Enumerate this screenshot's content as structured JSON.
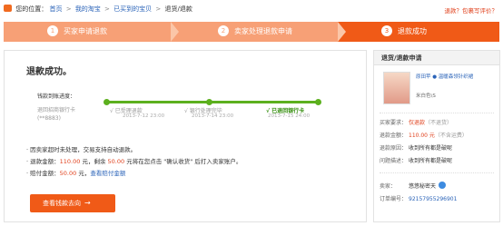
{
  "breadcrumb": {
    "prefix": "您的位置：",
    "home": "首页",
    "taobao": "我的淘宝",
    "bought": "已买到的宝贝",
    "current": "退货/退款",
    "sep": ">"
  },
  "top_link": "退款？包裹写评价？",
  "steps": [
    {
      "num": "1",
      "label": "买家申请退款"
    },
    {
      "num": "2",
      "label": "卖家处理退款申请"
    },
    {
      "num": "3",
      "label": "退款成功"
    }
  ],
  "main": {
    "title": "退款成功。",
    "track_head": "钱款到账进度：",
    "source_label": "退回招商银行卡",
    "source_no": "(**8883)",
    "stages": [
      {
        "label": "√ 已受理退款",
        "time": "2013-7-12 23:00"
      },
      {
        "label": "√ 银行处理完毕",
        "time": "2013-7-14 23:00"
      },
      {
        "label": "√ 已退回银行卡",
        "time": "2013-7-15 24:00"
      }
    ],
    "info_line1": "· 因卖家超时未处理，交易支持自动退款。",
    "info_line2_a": "· 退款金额：",
    "refund_amount": "110.00",
    "info_line2_b": " 元，剩余 ",
    "remain_amount": "50.00",
    "info_line2_c": " 元将在您点击 \"确认收货\" 后打入卖家账户。",
    "info_line3_a": "· 赔付金额：",
    "comp_amount": "50.00",
    "info_line3_b": " 元，",
    "comp_link": "查看赔付金额",
    "button_label": "查看钱款去向",
    "button_arrow": "→"
  },
  "sidebar": {
    "title": "退货/退款申请",
    "product_name": "原田苹 ● 温暖森领针织裙",
    "product_color": "米白色\\S",
    "rows": [
      {
        "k": "买家要求：",
        "v": "仅退款",
        "v2": "（不退货）"
      },
      {
        "k": "退款金额：",
        "v": "110.00 元",
        "v2": "（不含运费）"
      },
      {
        "k": "退款原因：",
        "v": "收到所有都是破呢",
        "v2": ""
      },
      {
        "k": "问题描述：",
        "v": "收到所有都是破呢",
        "v2": ""
      },
      {
        "k": "卖家：",
        "v": "悠悠秘密天",
        "v2": ""
      },
      {
        "k": "订单编号：",
        "v": "92157955296901",
        "v2": ""
      }
    ]
  },
  "colors": {
    "accent": "#f05a17",
    "accent_light": "#f7a076",
    "progress_green": "#5cb01e",
    "link": "#2a63b8",
    "price_red": "#e0401c"
  }
}
